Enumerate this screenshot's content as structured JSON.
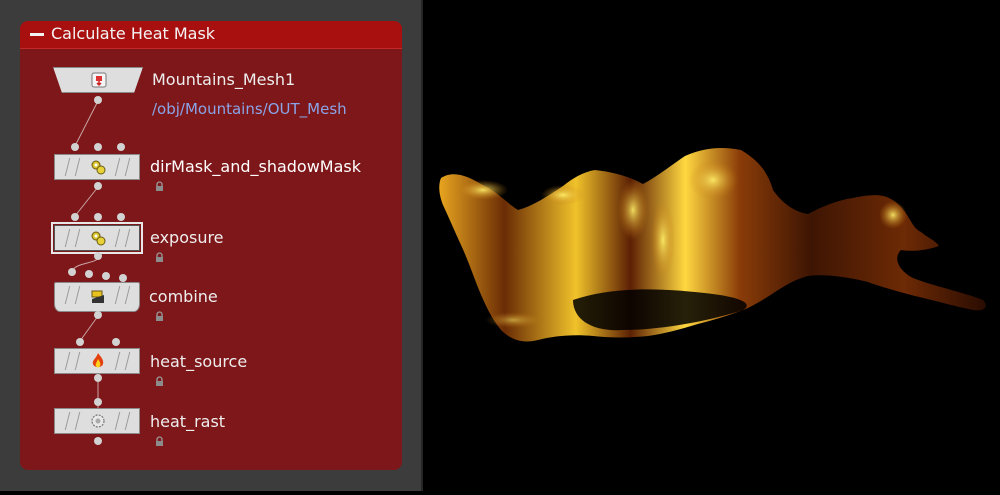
{
  "network": {
    "box_title": "Calculate Heat Mask",
    "nodes": [
      {
        "name": "Mountains_Mesh1",
        "path": "/obj/Mountains/OUT_Mesh",
        "icon": "object-merge-icon"
      },
      {
        "name": "dirMask_and_shadowMask",
        "icon": "gears-icon",
        "locked": true
      },
      {
        "name": "exposure",
        "icon": "gears-icon",
        "locked": true,
        "selected": true
      },
      {
        "name": "combine",
        "icon": "composite-icon",
        "locked": true
      },
      {
        "name": "heat_source",
        "icon": "fire-icon",
        "locked": true
      },
      {
        "name": "heat_rast",
        "icon": "rasterize-icon",
        "locked": true
      }
    ]
  },
  "colors": {
    "pane_background": "#3c3c3c",
    "netbox_fill": "#7e1719",
    "netbox_header": "#a8100f",
    "node_label_path": "#8aa4e8",
    "viewport_background": "#000000"
  }
}
